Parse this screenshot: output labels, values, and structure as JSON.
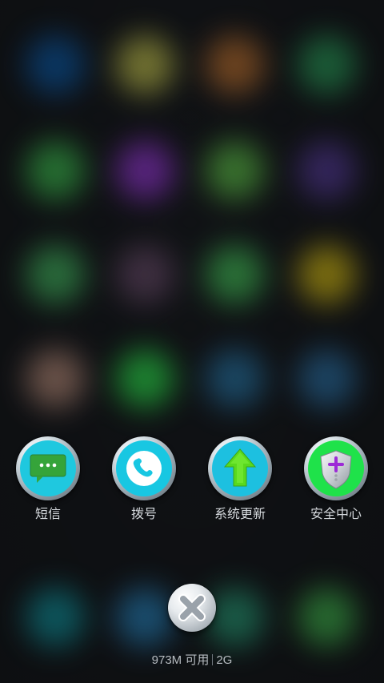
{
  "background": {
    "blurred_blobs": [
      {
        "color": "#0b3f72"
      },
      {
        "color": "#7e7e36"
      },
      {
        "color": "#7a4b23"
      },
      {
        "color": "#1f6a3f"
      },
      {
        "color": "#2b7f38"
      },
      {
        "color": "#5f2688"
      },
      {
        "color": "#3d7a31"
      },
      {
        "color": "#3b2a68"
      },
      {
        "color": "#2f7b43"
      },
      {
        "color": "#433245"
      },
      {
        "color": "#2d7a3b"
      },
      {
        "color": "#8d7d12"
      },
      {
        "color": "#7b5f54"
      },
      {
        "color": "#1f8f34"
      },
      {
        "color": "#1c4d6c"
      },
      {
        "color": "#204e71"
      },
      {
        "color": "#0f6870"
      },
      {
        "color": "#1e5b82"
      },
      {
        "color": "#1e6b53"
      },
      {
        "color": "#2f7f39"
      }
    ]
  },
  "shortcuts": [
    {
      "label": "短信",
      "icon": "message-icon",
      "inner_color": "#1fc8df",
      "accent_color": "#35a43a"
    },
    {
      "label": "拨号",
      "icon": "phone-icon",
      "inner_color": "#18c7e2",
      "accent_color": "#ffffff"
    },
    {
      "label": "系统更新",
      "icon": "update-arrow-icon",
      "inner_color": "#1dc0e0",
      "accent_color": "#59d91e"
    },
    {
      "label": "安全中心",
      "icon": "shield-icon",
      "inner_color": "#1fe24a",
      "accent_color": "#b7bcc2"
    }
  ],
  "close_button": {
    "icon": "close-icon"
  },
  "memory_status": {
    "available": "973M 可用",
    "total": "2G"
  }
}
